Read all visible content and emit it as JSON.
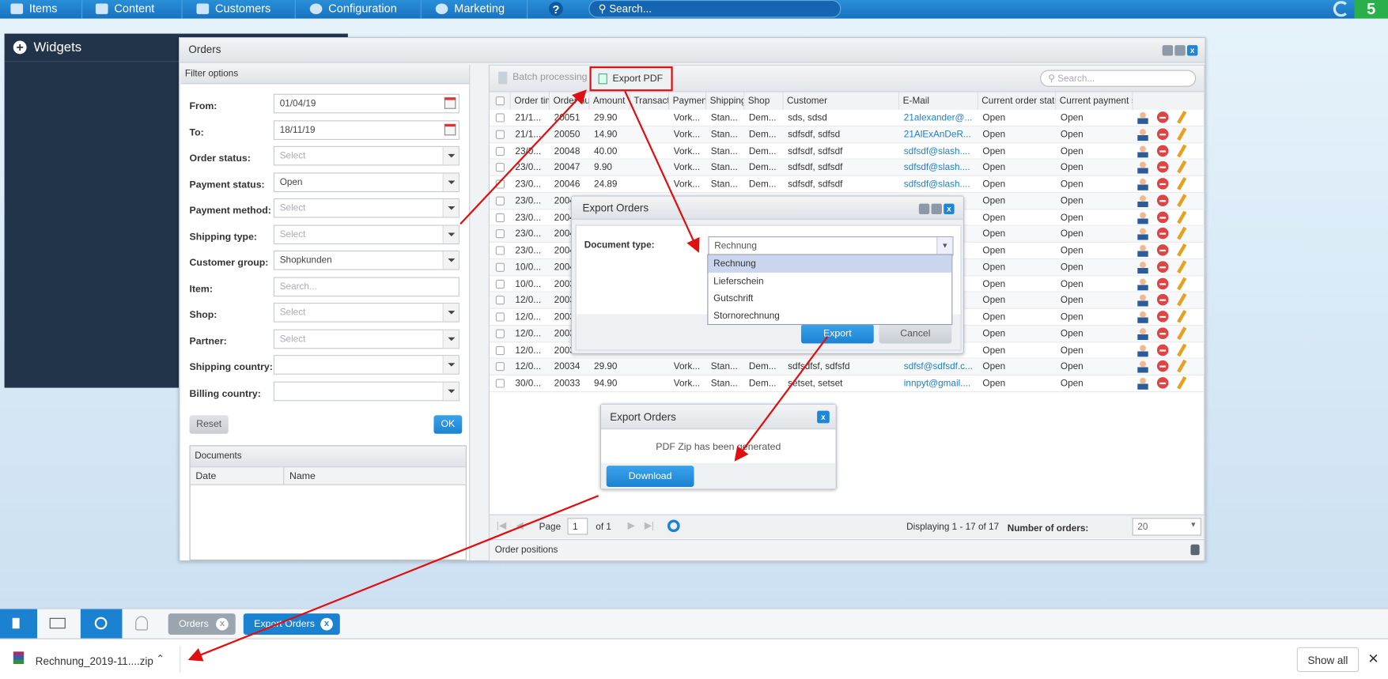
{
  "topnav": {
    "items": [
      "Items",
      "Content",
      "Customers",
      "Configuration",
      "Marketing"
    ],
    "help_icon": "question-icon",
    "search_placeholder": "Search...",
    "logo_letter": "5"
  },
  "widgets": {
    "title": "Widgets"
  },
  "orders_window": {
    "title": "Orders",
    "filter": {
      "title": "Filter options",
      "fields": [
        {
          "label": "From:",
          "value": "01/04/19",
          "type": "date"
        },
        {
          "label": "To:",
          "value": "18/11/19",
          "type": "date"
        },
        {
          "label": "Order status:",
          "value": "Select",
          "type": "select",
          "placeholder": true
        },
        {
          "label": "Payment status:",
          "value": "Open",
          "type": "select"
        },
        {
          "label": "Payment method:",
          "value": "Select",
          "type": "select",
          "placeholder": true
        },
        {
          "label": "Shipping type:",
          "value": "Select",
          "type": "select",
          "placeholder": true
        },
        {
          "label": "Customer group:",
          "value": "Shopkunden",
          "type": "select"
        },
        {
          "label": "Item:",
          "value": "Search...",
          "type": "text",
          "placeholder": true
        },
        {
          "label": "Shop:",
          "value": "Select",
          "type": "select",
          "placeholder": true
        },
        {
          "label": "Partner:",
          "value": "Select",
          "type": "select",
          "placeholder": true
        },
        {
          "label": "Shipping country:",
          "value": "",
          "type": "select"
        },
        {
          "label": "Billing country:",
          "value": "",
          "type": "select"
        }
      ],
      "reset": "Reset",
      "ok": "OK",
      "documents": {
        "title": "Documents",
        "columns": [
          "Date",
          "Name"
        ]
      }
    },
    "toolbar": {
      "batch": "Batch processing",
      "export_pdf": "Export PDF",
      "search_placeholder": "Search..."
    },
    "columns": [
      "Order tim",
      "Order nu",
      "Amount",
      "Transact",
      "Paymen",
      "Shipping",
      "Shop",
      "Customer",
      "E-Mail",
      "Current order statu",
      "Current payment s"
    ],
    "rows": [
      [
        "21/1...",
        "20051",
        "29.90",
        "",
        "Vork...",
        "Stan...",
        "Dem...",
        "sds, sdsd",
        "21alexander@...",
        "Open",
        "Open"
      ],
      [
        "21/1...",
        "20050",
        "14.90",
        "",
        "Vork...",
        "Stan...",
        "Dem...",
        "sdfsdf, sdfsd",
        "21AlExAnDeR...",
        "Open",
        "Open"
      ],
      [
        "23/0...",
        "20048",
        "40.00",
        "",
        "Vork...",
        "Stan...",
        "Dem...",
        "sdfsdf, sdfsdf",
        "sdfsdf@slash....",
        "Open",
        "Open"
      ],
      [
        "23/0...",
        "20047",
        "9.90",
        "",
        "Vork...",
        "Stan...",
        "Dem...",
        "sdfsdf, sdfsdf",
        "sdfsdf@slash....",
        "Open",
        "Open"
      ],
      [
        "23/0...",
        "20046",
        "24.89",
        "",
        "Vork...",
        "Stan...",
        "Dem...",
        "sdfsdf, sdfsdf",
        "sdfsdf@slash....",
        "Open",
        "Open"
      ],
      [
        "23/0...",
        "2004",
        "",
        "",
        "",
        "",
        "",
        "",
        "",
        "Open",
        "Open"
      ],
      [
        "23/0...",
        "2004",
        "",
        "",
        "",
        "",
        "",
        "",
        "",
        "Open",
        "Open"
      ],
      [
        "23/0...",
        "2004",
        "",
        "",
        "",
        "",
        "",
        "",
        "",
        "Open",
        "Open"
      ],
      [
        "23/0...",
        "2004",
        "",
        "",
        "",
        "",
        "",
        "",
        "",
        "Open",
        "Open"
      ],
      [
        "10/0...",
        "2004",
        "",
        "",
        "",
        "",
        "",
        "",
        "",
        "Open",
        "Open"
      ],
      [
        "10/0...",
        "2003",
        "",
        "",
        "",
        "",
        "",
        "",
        "",
        "Open",
        "Open"
      ],
      [
        "12/0...",
        "2003",
        "",
        "",
        "",
        "",
        "",
        "",
        "",
        "Open",
        "Open"
      ],
      [
        "12/0...",
        "2003",
        "",
        "",
        "",
        "",
        "",
        "",
        "",
        "Open",
        "Open"
      ],
      [
        "12/0...",
        "2003",
        "",
        "",
        "",
        "",
        "",
        "",
        "",
        "Open",
        "Open"
      ],
      [
        "12/0...",
        "2003",
        "",
        "",
        "",
        "",
        "",
        "",
        "",
        "Open",
        "Open"
      ],
      [
        "12/0...",
        "20034",
        "29.90",
        "",
        "Vork...",
        "Stan...",
        "Dem...",
        "sdfsdfsf, sdfsfd",
        "sdfsf@sdfsdf.c...",
        "Open",
        "Open"
      ],
      [
        "30/0...",
        "20033",
        "94.90",
        "",
        "Vork...",
        "Stan...",
        "Dem...",
        "setset, setset",
        "innpyt@gmail....",
        "Open",
        "Open"
      ]
    ],
    "pager": {
      "page_label": "Page",
      "page": "1",
      "of": "of 1",
      "displaying": "Displaying 1 - 17 of 17",
      "num_label": "Number of orders:",
      "num_value": "20"
    },
    "order_positions": "Order positions"
  },
  "export_dialog": {
    "title": "Export Orders",
    "doc_type_label": "Document type:",
    "selected": "Rechnung",
    "options": [
      "Rechnung",
      "Lieferschein",
      "Gutschrift",
      "Stornorechnung"
    ],
    "export": "Export",
    "cancel": "Cancel"
  },
  "done_dialog": {
    "title": "Export Orders",
    "message": "PDF Zip has been generated",
    "download": "Download"
  },
  "taskbar": {
    "tabs": [
      "Orders",
      "Export Orders"
    ]
  },
  "download_bar": {
    "file": "Rechnung_2019-11....zip",
    "show_all": "Show all"
  },
  "colors": {
    "accent": "#1b82d2",
    "annotation": "#e01010"
  }
}
